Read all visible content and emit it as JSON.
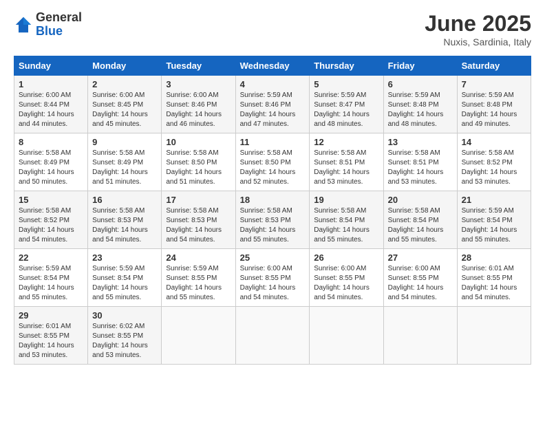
{
  "logo": {
    "general": "General",
    "blue": "Blue"
  },
  "title": "June 2025",
  "subtitle": "Nuxis, Sardinia, Italy",
  "days": [
    "Sunday",
    "Monday",
    "Tuesday",
    "Wednesday",
    "Thursday",
    "Friday",
    "Saturday"
  ],
  "weeks": [
    [
      {
        "day": "1",
        "sunrise": "6:00 AM",
        "sunset": "8:44 PM",
        "daylight": "14 hours and 44 minutes."
      },
      {
        "day": "2",
        "sunrise": "6:00 AM",
        "sunset": "8:45 PM",
        "daylight": "14 hours and 45 minutes."
      },
      {
        "day": "3",
        "sunrise": "6:00 AM",
        "sunset": "8:46 PM",
        "daylight": "14 hours and 46 minutes."
      },
      {
        "day": "4",
        "sunrise": "5:59 AM",
        "sunset": "8:46 PM",
        "daylight": "14 hours and 47 minutes."
      },
      {
        "day": "5",
        "sunrise": "5:59 AM",
        "sunset": "8:47 PM",
        "daylight": "14 hours and 48 minutes."
      },
      {
        "day": "6",
        "sunrise": "5:59 AM",
        "sunset": "8:48 PM",
        "daylight": "14 hours and 48 minutes."
      },
      {
        "day": "7",
        "sunrise": "5:59 AM",
        "sunset": "8:48 PM",
        "daylight": "14 hours and 49 minutes."
      }
    ],
    [
      {
        "day": "8",
        "sunrise": "5:58 AM",
        "sunset": "8:49 PM",
        "daylight": "14 hours and 50 minutes."
      },
      {
        "day": "9",
        "sunrise": "5:58 AM",
        "sunset": "8:49 PM",
        "daylight": "14 hours and 51 minutes."
      },
      {
        "day": "10",
        "sunrise": "5:58 AM",
        "sunset": "8:50 PM",
        "daylight": "14 hours and 51 minutes."
      },
      {
        "day": "11",
        "sunrise": "5:58 AM",
        "sunset": "8:50 PM",
        "daylight": "14 hours and 52 minutes."
      },
      {
        "day": "12",
        "sunrise": "5:58 AM",
        "sunset": "8:51 PM",
        "daylight": "14 hours and 53 minutes."
      },
      {
        "day": "13",
        "sunrise": "5:58 AM",
        "sunset": "8:51 PM",
        "daylight": "14 hours and 53 minutes."
      },
      {
        "day": "14",
        "sunrise": "5:58 AM",
        "sunset": "8:52 PM",
        "daylight": "14 hours and 53 minutes."
      }
    ],
    [
      {
        "day": "15",
        "sunrise": "5:58 AM",
        "sunset": "8:52 PM",
        "daylight": "14 hours and 54 minutes."
      },
      {
        "day": "16",
        "sunrise": "5:58 AM",
        "sunset": "8:53 PM",
        "daylight": "14 hours and 54 minutes."
      },
      {
        "day": "17",
        "sunrise": "5:58 AM",
        "sunset": "8:53 PM",
        "daylight": "14 hours and 54 minutes."
      },
      {
        "day": "18",
        "sunrise": "5:58 AM",
        "sunset": "8:53 PM",
        "daylight": "14 hours and 55 minutes."
      },
      {
        "day": "19",
        "sunrise": "5:58 AM",
        "sunset": "8:54 PM",
        "daylight": "14 hours and 55 minutes."
      },
      {
        "day": "20",
        "sunrise": "5:58 AM",
        "sunset": "8:54 PM",
        "daylight": "14 hours and 55 minutes."
      },
      {
        "day": "21",
        "sunrise": "5:59 AM",
        "sunset": "8:54 PM",
        "daylight": "14 hours and 55 minutes."
      }
    ],
    [
      {
        "day": "22",
        "sunrise": "5:59 AM",
        "sunset": "8:54 PM",
        "daylight": "14 hours and 55 minutes."
      },
      {
        "day": "23",
        "sunrise": "5:59 AM",
        "sunset": "8:54 PM",
        "daylight": "14 hours and 55 minutes."
      },
      {
        "day": "24",
        "sunrise": "5:59 AM",
        "sunset": "8:55 PM",
        "daylight": "14 hours and 55 minutes."
      },
      {
        "day": "25",
        "sunrise": "6:00 AM",
        "sunset": "8:55 PM",
        "daylight": "14 hours and 54 minutes."
      },
      {
        "day": "26",
        "sunrise": "6:00 AM",
        "sunset": "8:55 PM",
        "daylight": "14 hours and 54 minutes."
      },
      {
        "day": "27",
        "sunrise": "6:00 AM",
        "sunset": "8:55 PM",
        "daylight": "14 hours and 54 minutes."
      },
      {
        "day": "28",
        "sunrise": "6:01 AM",
        "sunset": "8:55 PM",
        "daylight": "14 hours and 54 minutes."
      }
    ],
    [
      {
        "day": "29",
        "sunrise": "6:01 AM",
        "sunset": "8:55 PM",
        "daylight": "14 hours and 53 minutes."
      },
      {
        "day": "30",
        "sunrise": "6:02 AM",
        "sunset": "8:55 PM",
        "daylight": "14 hours and 53 minutes."
      },
      null,
      null,
      null,
      null,
      null
    ]
  ],
  "labels": {
    "sunrise": "Sunrise:",
    "sunset": "Sunset:",
    "daylight": "Daylight:"
  }
}
